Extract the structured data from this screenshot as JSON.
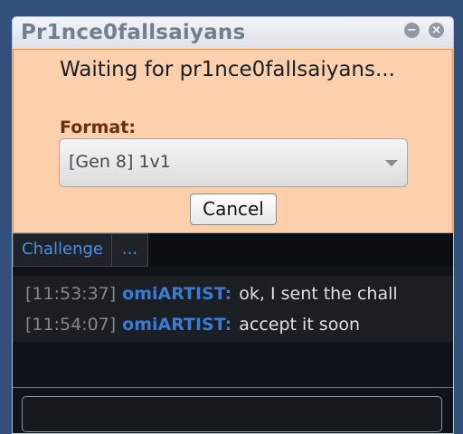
{
  "window": {
    "title": "Pr1nce0fallsaiyans",
    "minimize_glyph": "−",
    "close_glyph": "×"
  },
  "challenge": {
    "waiting_text": "Waiting for pr1nce0fallsaiyans...",
    "format_label": "Format:",
    "format_value": "[Gen 8] 1v1",
    "cancel_label": "Cancel"
  },
  "tabs": [
    {
      "label": "Challenge"
    },
    {
      "label": "..."
    }
  ],
  "messages": [
    {
      "timestamp": "[11:53:37]",
      "user": "omiARTIST:",
      "text": "ok, I sent the chall"
    },
    {
      "timestamp": "[11:54:07]",
      "user": "omiARTIST:",
      "text": "accept it soon"
    }
  ],
  "colors": {
    "page_background": "#33507a",
    "challenge_background": "#fdd0ad",
    "format_label": "#6a2d0d",
    "username": "#3a7bd4",
    "tab_text": "#4b8fe2"
  }
}
